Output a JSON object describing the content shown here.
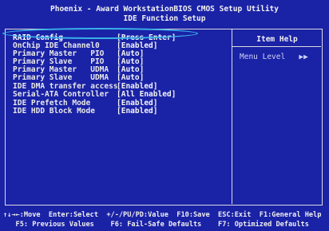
{
  "header": {
    "title": "Phoenix - Award WorkstationBIOS CMOS Setup Utility",
    "subtitle": "IDE Function Setup"
  },
  "settings": [
    {
      "label": "RAID Config",
      "value": "[Press Enter]"
    },
    {
      "label": "OnChip IDE Channel0",
      "value": "[Enabled]"
    },
    {
      "label": "Primary Master   PIO",
      "value": "[Auto]"
    },
    {
      "label": "Primary Slave    PIO",
      "value": "[Auto]"
    },
    {
      "label": "Primary Master   UDMA",
      "value": "[Auto]"
    },
    {
      "label": "Primary Slave    UDMA",
      "value": "[Auto]"
    },
    {
      "label": "IDE DMA transfer access",
      "value": "[Enabled]"
    },
    {
      "label": "Serial-ATA Controller",
      "value": "[All Enabled]"
    },
    {
      "label": "IDE Prefetch Mode",
      "value": "[Enabled]"
    },
    {
      "label": "IDE HDD Block Mode",
      "value": "[Enabled]"
    }
  ],
  "help": {
    "title": "Item Help",
    "menu_level": "Menu Level   ▶▶"
  },
  "footer": {
    "line1": "↑↓→←:Move  Enter:Select  +/-/PU/PD:Value  F10:Save  ESC:Exit  F1:General Help",
    "line2": "   F5: Previous Values    F6: Fail-Safe Defaults    F7: Optimized Defaults"
  },
  "colors": {
    "background": "#1a22a6",
    "annotation": "#3ab0e8"
  }
}
